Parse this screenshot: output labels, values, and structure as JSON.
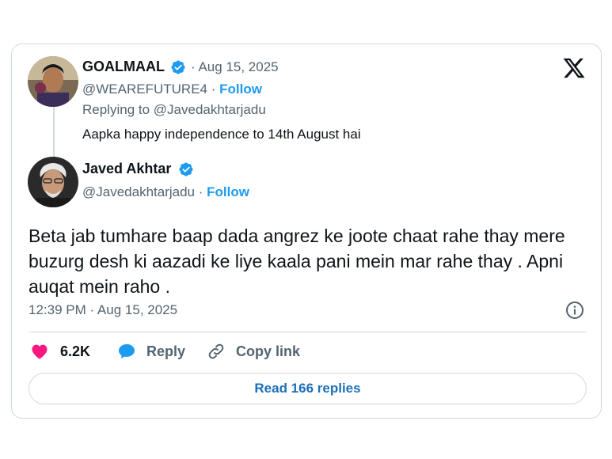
{
  "reply_to_tweet": {
    "name": "GOALMAAL",
    "date": "Aug 15, 2025",
    "handle": "@WEAREFUTURE4",
    "separator": "·",
    "follow_label": "Follow",
    "replying_to": "Replying to @Javedakhtarjadu",
    "text": "Aapka happy independence to 14th August hai"
  },
  "main_tweet": {
    "name": "Javed Akhtar",
    "handle": "@Javedakhtarjadu",
    "separator": "·",
    "follow_label": "Follow",
    "text": "Beta jab tumhare baap dada angrez ke joote chaat rahe thay mere buzurg desh ki aazadi ke liye kaala pani mein mar rahe thay . Apni auqat mein raho .",
    "timestamp": "12:39 PM · Aug 15, 2025"
  },
  "actions": {
    "likes": "6.2K",
    "reply_label": "Reply",
    "copy_link_label": "Copy link"
  },
  "read_replies_label": "Read 166 replies",
  "colors": {
    "accent": "#1d9bf0",
    "like": "#f91880",
    "muted": "#536471",
    "border": "#cfd9de"
  },
  "icons": [
    "verified-icon",
    "x-logo-icon",
    "info-icon",
    "heart-icon",
    "reply-icon",
    "link-icon"
  ]
}
